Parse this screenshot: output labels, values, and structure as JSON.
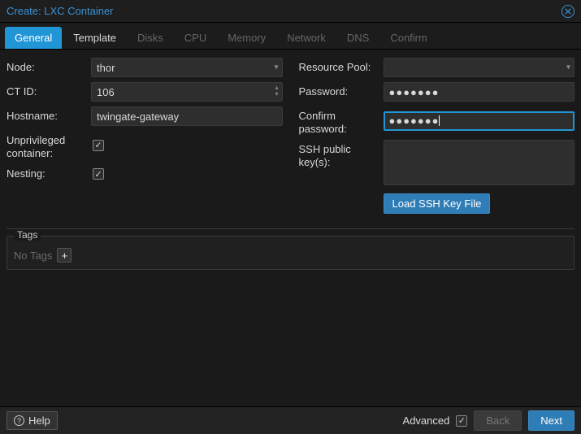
{
  "dialog": {
    "title": "Create: LXC Container"
  },
  "tabs": [
    {
      "label": "General",
      "state": "active"
    },
    {
      "label": "Template",
      "state": "enabled"
    },
    {
      "label": "Disks",
      "state": "disabled"
    },
    {
      "label": "CPU",
      "state": "disabled"
    },
    {
      "label": "Memory",
      "state": "disabled"
    },
    {
      "label": "Network",
      "state": "disabled"
    },
    {
      "label": "DNS",
      "state": "disabled"
    },
    {
      "label": "Confirm",
      "state": "disabled"
    }
  ],
  "left": {
    "node_label": "Node:",
    "node_value": "thor",
    "ctid_label": "CT ID:",
    "ctid_value": "106",
    "hostname_label": "Hostname:",
    "hostname_value": "twingate-gateway",
    "unpriv_label": "Unprivileged container:",
    "unpriv_checked": true,
    "nesting_label": "Nesting:",
    "nesting_checked": true
  },
  "right": {
    "pool_label": "Resource Pool:",
    "pool_value": "",
    "password_label": "Password:",
    "password_mask": "●●●●●●●",
    "confirm_label": "Confirm password:",
    "confirm_mask": "●●●●●●●",
    "ssh_label": "SSH public key(s):",
    "ssh_value": "",
    "load_ssh_label": "Load SSH Key File"
  },
  "tags": {
    "legend": "Tags",
    "empty_text": "No Tags"
  },
  "footer": {
    "help_label": "Help",
    "advanced_label": "Advanced",
    "advanced_checked": true,
    "back_label": "Back",
    "next_label": "Next"
  }
}
